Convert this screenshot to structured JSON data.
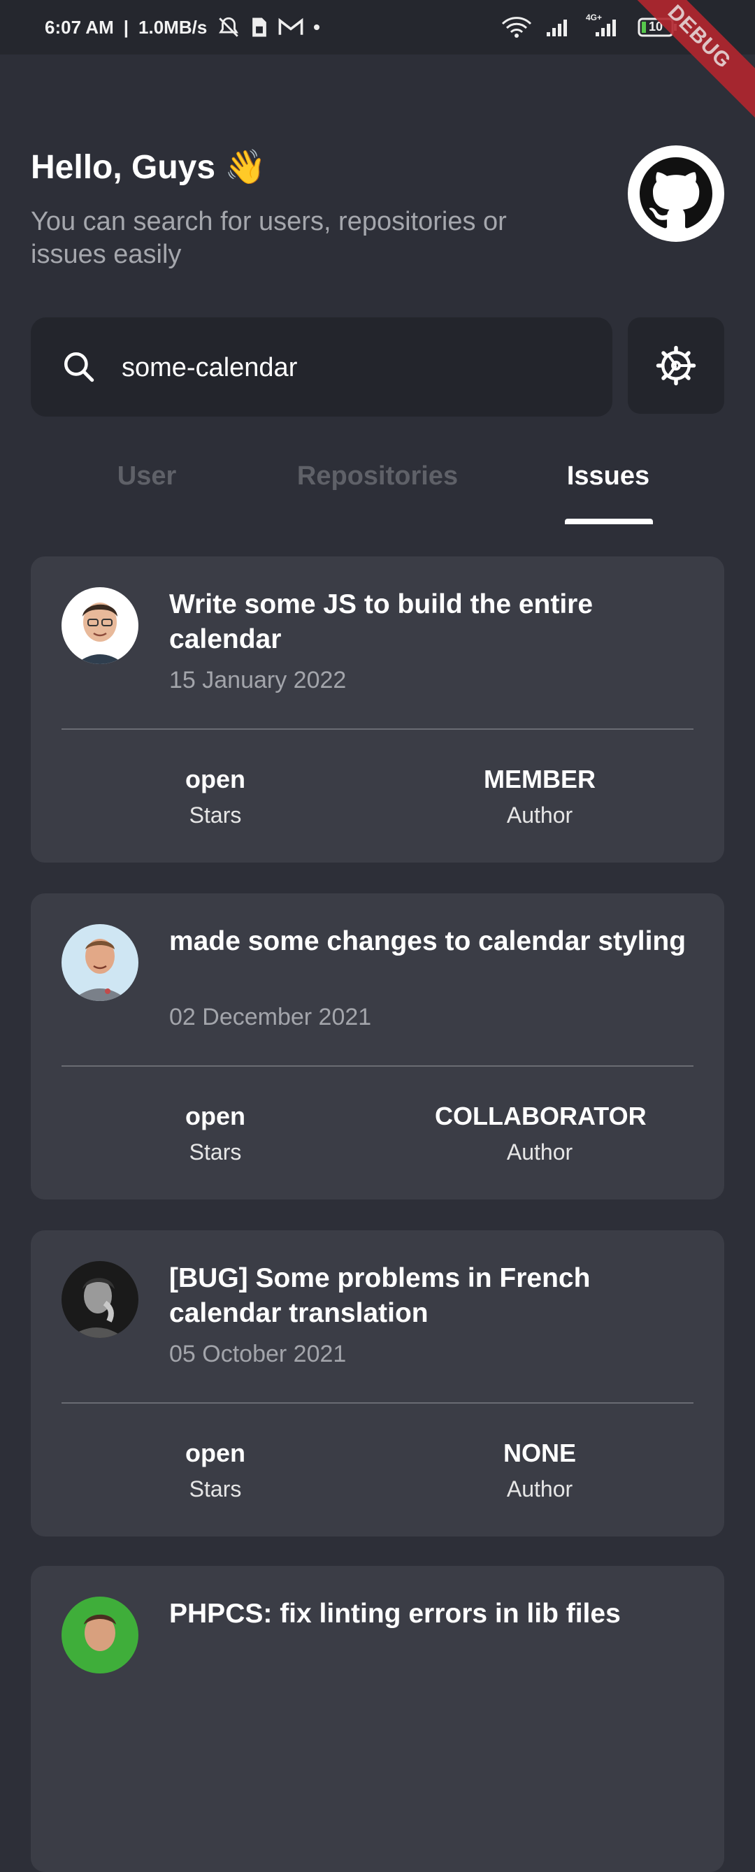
{
  "status_bar": {
    "time": "6:07 AM",
    "speed": "1.0MB/s",
    "network": "4G+",
    "battery": "10",
    "debug_label": "DEBUG"
  },
  "header": {
    "greeting": "Hello, Guys 👋",
    "subtitle": "You can search for users, repositories or issues easily"
  },
  "search": {
    "value": "some-calendar"
  },
  "tabs": [
    {
      "label": "User",
      "active": false
    },
    {
      "label": "Repositories",
      "active": false
    },
    {
      "label": "Issues",
      "active": true
    }
  ],
  "issues": [
    {
      "title": "Write some JS to build the entire calendar",
      "date": "15 January 2022",
      "state": "open",
      "state_label": "Stars",
      "association": "MEMBER",
      "association_label": "Author"
    },
    {
      "title": "made some changes to calendar styling",
      "date": "02 December 2021",
      "state": "open",
      "state_label": "Stars",
      "association": "COLLABORATOR",
      "association_label": "Author"
    },
    {
      "title": "[BUG] Some problems in French calendar translation",
      "date": "05 October 2021",
      "state": "open",
      "state_label": "Stars",
      "association": "NONE",
      "association_label": "Author"
    },
    {
      "title": "PHPCS: fix linting errors in lib files",
      "date": "",
      "state": "",
      "state_label": "",
      "association": "",
      "association_label": ""
    }
  ],
  "colors": {
    "background": "#2d2f38",
    "card": "#3b3d46",
    "search_bg": "#23252c",
    "muted_text": "#a5a7ad",
    "inactive_tab": "#5f6168"
  }
}
